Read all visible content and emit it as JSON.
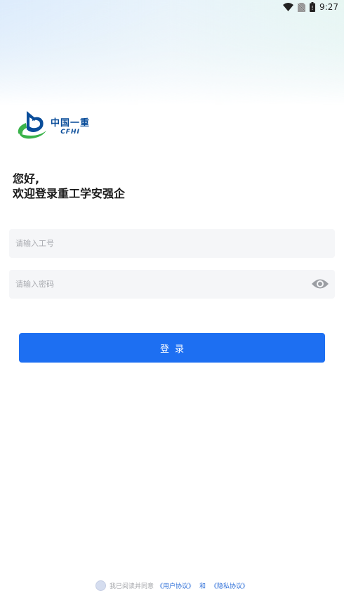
{
  "status": {
    "time": "9:27"
  },
  "logo": {
    "cn": "中国一重",
    "en": "CFHI"
  },
  "greeting": {
    "line1": "您好,",
    "line2": "欢迎登录重工学安强企"
  },
  "form": {
    "employee_placeholder": "请输入工号",
    "password_placeholder": "请输入密码",
    "employee_value": "",
    "password_value": ""
  },
  "login": {
    "label": "登录"
  },
  "agreement": {
    "prefix": "我已阅读并同意",
    "user_link": "《用户协议》",
    "and": "和",
    "privacy_link": "《隐私协议》"
  },
  "colors": {
    "primary": "#1d6ff2",
    "link": "#2e6fd8",
    "brand_blue": "#0a4d9a",
    "brand_green": "#3ab34a"
  },
  "icons": [
    "wifi-icon",
    "no-sim-icon",
    "battery-icon",
    "eye-icon",
    "radio-unchecked-icon"
  ]
}
